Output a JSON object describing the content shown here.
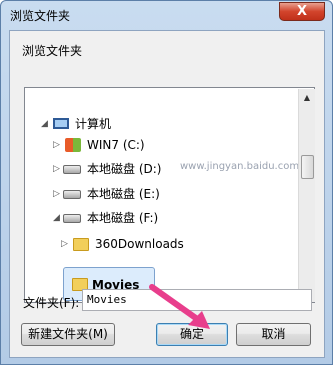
{
  "window": {
    "title": "浏览文件夹",
    "close_label": "X"
  },
  "prompt": "浏览文件夹",
  "tree": {
    "items": [
      {
        "label": "计算机",
        "expanded": true
      },
      {
        "label": "WIN7 (C:)",
        "expanded": false
      },
      {
        "label": "本地磁盘 (D:)",
        "expanded": false
      },
      {
        "label": "本地磁盘 (E:)",
        "expanded": false
      },
      {
        "label": "本地磁盘 (F:)",
        "expanded": true
      },
      {
        "label": "360Downloads",
        "expanded": false
      },
      {
        "label": "Movies",
        "selected": true
      }
    ],
    "watermark": "www.jingyan.baidu.com"
  },
  "folder_field": {
    "label": "文件夹(F):",
    "value": "Movies"
  },
  "buttons": {
    "new_folder": "新建文件夹(M)",
    "ok": "确定",
    "cancel": "取消"
  },
  "colors": {
    "accent": "#e83e8c",
    "selection": "#dcecfc"
  }
}
